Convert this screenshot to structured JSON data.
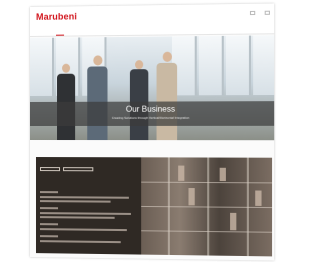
{
  "header": {
    "logo_text": "Marubeni",
    "utility_links": [
      "",
      "",
      "",
      "",
      ""
    ]
  },
  "nav": {
    "items": [
      "",
      "",
      "",
      "",
      "",
      "",
      ""
    ]
  },
  "hero": {
    "title": "Our Business",
    "subtitle": "Creating Solutions through Vertical/Horizontal Integration"
  },
  "breadcrumb": "",
  "content": {
    "section_title": "",
    "news_title": "",
    "accent_color": "#d2161e"
  }
}
